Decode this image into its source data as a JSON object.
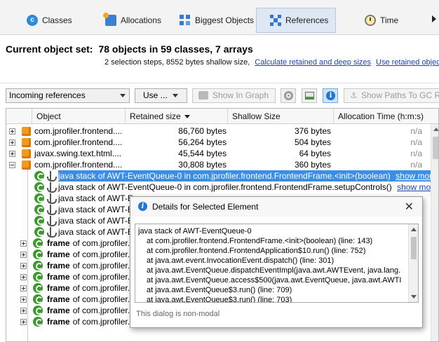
{
  "tabs": [
    {
      "label": "Classes",
      "icon": "classes-icon"
    },
    {
      "label": "Allocations",
      "icon": "allocations-icon"
    },
    {
      "label": "Biggest Objects",
      "icon": "biggest-objects-icon"
    },
    {
      "label": "References",
      "icon": "references-icon",
      "active": true
    },
    {
      "label": "Time",
      "icon": "time-icon"
    }
  ],
  "header": {
    "label": "Current object set:",
    "value": "78 objects in 59 classes, 7 arrays",
    "steps": "2 selection steps, 8552 bytes shallow size,",
    "link_retained": "Calculate retained and deep sizes",
    "link_use": "Use retained objects"
  },
  "toolbar": {
    "mode": "Incoming references",
    "use": "Use ...",
    "show_in_graph": "Show In Graph",
    "show_paths": "Show Paths To GC Roots"
  },
  "columns": {
    "object": "Object",
    "retained": "Retained size",
    "shallow": "Shallow Size",
    "alloc": "Allocation Time (h:m:s)"
  },
  "rows": [
    {
      "name": "com.jprofiler.frontend....",
      "retained": "86,760 bytes",
      "shallow": "376 bytes",
      "alloc": "n/a"
    },
    {
      "name": "com.jprofiler.frontend....",
      "retained": "56,264 bytes",
      "shallow": "504 bytes",
      "alloc": "n/a"
    },
    {
      "name": "javax.swing.text.html....",
      "retained": "45,544 bytes",
      "shallow": "64 bytes",
      "alloc": "n/a"
    },
    {
      "name": "com.jprofiler.frontend....",
      "retained": "30,808 bytes",
      "shallow": "360 bytes",
      "alloc": "n/a"
    }
  ],
  "stack_rows": [
    {
      "text": "java stack of AWT-EventQueue-0 in com.jprofiler.frontend.FrontendFrame.<init>(boolean)",
      "more": "show more",
      "selected": true
    },
    {
      "text": "java stack of AWT-EventQueue-0 in com.jprofiler.frontend.FrontendFrame.setupControls()",
      "more": "show more"
    },
    {
      "text": "java stack of AWT-Eve"
    },
    {
      "text": "java stack of AWT-Eve"
    },
    {
      "text": "java stack of AWT-Eve"
    },
    {
      "text": "java stack of AWT-Eve"
    }
  ],
  "frame_rows": [
    {
      "kw": "frame",
      "text": "of com.jprofiler.f"
    },
    {
      "kw": "frame",
      "text": "of com.jprofiler.f"
    },
    {
      "kw": "frame",
      "text": "of com.jprofiler.f"
    },
    {
      "kw": "frame",
      "text": "of com.jprofiler.f"
    },
    {
      "kw": "frame",
      "text": "of com.jprofiler.f"
    },
    {
      "kw": "frame",
      "text": "of com.jprofiler.f"
    },
    {
      "kw": "frame",
      "text": "of com.jprofiler.f"
    },
    {
      "kw": "frame",
      "text": "of com.jprofiler.f"
    }
  ],
  "dialog": {
    "title": "Details for Selected Element",
    "close": "✕",
    "lines": [
      "java stack of AWT-EventQueue-0",
      "at com.jprofiler.frontend.FrontendFrame.<init>(boolean) (line: 143)",
      "at com.jprofiler.frontend.FrontendApplication$10.run() (line: 752)",
      "at java.awt.event.InvocationEvent.dispatch() (line: 301)",
      "at java.awt.EventQueue.dispatchEventImpl(java.awt.AWTEvent, java.lang.",
      "at java.awt.EventQueue.access$500(java.awt.EventQueue, java.awt.AWTI",
      "at java.awt.EventQueue$3.run() (line: 709)",
      "at java.awt.EventQueue$3.run() (line: 703)"
    ],
    "footer": "This dialog is non-modal"
  },
  "colors": {
    "selection": "#3a8ee6",
    "link": "#1a46b4",
    "class_icon": "#f29a1c",
    "gc_icon": "#3a9a2b"
  }
}
